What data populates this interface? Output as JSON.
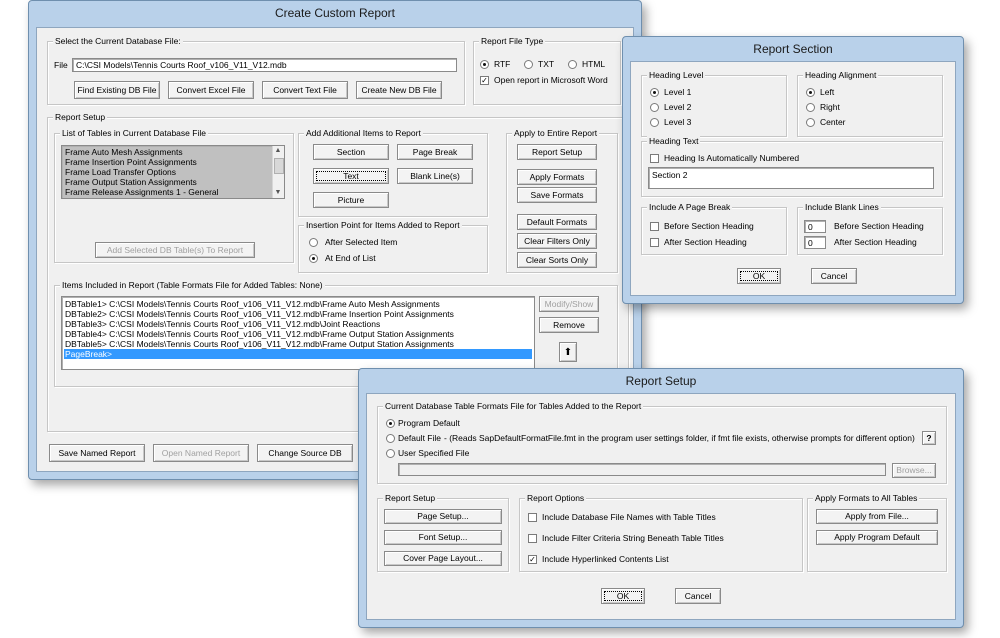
{
  "create_custom_report": {
    "title": "Create Custom Report",
    "db_group_title": "Select the Current Database File:",
    "file_label": "File",
    "file_path": "C:\\CSI Models\\Tennis Courts Roof_v106_V11_V12.mdb",
    "buttons": {
      "find_existing": "Find Existing DB File",
      "convert_excel": "Convert Excel File",
      "convert_text": "Convert Text File",
      "create_new": "Create New DB File"
    },
    "file_type": {
      "title": "Report File Type",
      "options": [
        "RTF",
        "TXT",
        "HTML"
      ],
      "selected": "RTF",
      "open_in_word": "Open report in Microsoft Word"
    },
    "report_setup_title": "Report Setup",
    "tables_list": {
      "title": "List of Tables in Current Database File",
      "items": [
        "Frame Auto Mesh Assignments",
        "Frame Insertion Point Assignments",
        "Frame Load Transfer Options",
        "Frame Output Station Assignments",
        "Frame Release Assignments 1 - General"
      ],
      "add_button": "Add Selected DB Table(s) To Report"
    },
    "additional_items": {
      "title": "Add Additional Items to Report",
      "section": "Section",
      "page_break": "Page Break",
      "text": "Text",
      "blank_lines": "Blank Line(s)",
      "picture": "Picture"
    },
    "insertion_point": {
      "title": "Insertion Point for Items Added to Report",
      "after_selected": "After Selected Item",
      "at_end": "At End of List"
    },
    "apply_entire": {
      "title": "Apply to Entire Report",
      "report_setup": "Report Setup",
      "apply_formats": "Apply Formats",
      "save_formats": "Save Formats",
      "default_formats": "Default Formats",
      "clear_filters": "Clear Filters Only",
      "clear_sorts": "Clear Sorts Only"
    },
    "items_included": {
      "title": "Items Included in Report  (Table Formats File for Added Tables:  None)",
      "rows": [
        "DBTable1>  C:\\CSI Models\\Tennis Courts Roof_v106_V11_V12.mdb\\Frame Auto Mesh Assignments",
        "DBTable2>  C:\\CSI Models\\Tennis Courts Roof_v106_V11_V12.mdb\\Frame Insertion Point Assignments",
        "DBTable3>  C:\\CSI Models\\Tennis Courts Roof_v106_V11_V12.mdb\\Joint Reactions",
        "DBTable4>  C:\\CSI Models\\Tennis Courts Roof_v106_V11_V12.mdb\\Frame Output Station Assignments",
        "DBTable5>  C:\\CSI Models\\Tennis Courts Roof_v106_V11_V12.mdb\\Frame Output Station Assignments",
        "PageBreak>"
      ],
      "modify_show": "Modify/Show",
      "remove": "Remove",
      "move_up_icon": "arrow-up-icon"
    },
    "bottom": {
      "save_named": "Save Named Report",
      "open_named": "Open Named Report",
      "change_source": "Change Source DB"
    }
  },
  "report_section": {
    "title": "Report Section",
    "heading_level": {
      "title": "Heading Level",
      "options": [
        "Level 1",
        "Level 2",
        "Level 3"
      ],
      "selected": "Level 1"
    },
    "heading_alignment": {
      "title": "Heading Alignment",
      "options": [
        "Left",
        "Right",
        "Center"
      ],
      "selected": "Left"
    },
    "heading_text": {
      "title": "Heading Text",
      "auto_number": "Heading Is Automatically Numbered",
      "value": "Section 2"
    },
    "page_break": {
      "title": "Include A Page Break",
      "before": "Before Section Heading",
      "after": "After Section Heading"
    },
    "blank_lines": {
      "title": "Include Blank Lines",
      "before_value": "0",
      "before": "Before Section Heading",
      "after_value": "0",
      "after": "After Section Heading"
    },
    "ok": "OK",
    "cancel": "Cancel"
  },
  "report_setup": {
    "title": "Report Setup",
    "formats_file": {
      "title": "Current Database Table Formats File for Tables Added to the Report",
      "program_default": "Program Default",
      "default_file": "Default File",
      "default_file_note": "-  (Reads SapDefaultFormatFile.fmt in the program user settings folder, if fmt file exists, otherwise prompts for different option)",
      "help": "?",
      "user_specified": "User Specified File",
      "browse": "Browse...",
      "selected": "Program Default"
    },
    "setup": {
      "title": "Report Setup",
      "page_setup": "Page Setup...",
      "font_setup": "Font Setup...",
      "cover_page": "Cover Page Layout..."
    },
    "options": {
      "title": "Report Options",
      "include_names": "Include Database File Names with Table Titles",
      "include_filter": "Include Filter Criteria String Beneath Table Titles",
      "include_hyperlinked": "Include Hyperlinked Contents List",
      "hyperlinked_checked": true
    },
    "apply_formats": {
      "title": "Apply Formats to All Tables",
      "apply_from_file": "Apply from File...",
      "apply_default": "Apply Program Default"
    },
    "ok": "OK",
    "cancel": "Cancel"
  },
  "colors": {
    "titlebar": "#b9d1ea",
    "selection": "#3399ff",
    "face": "#f0f0f0"
  }
}
